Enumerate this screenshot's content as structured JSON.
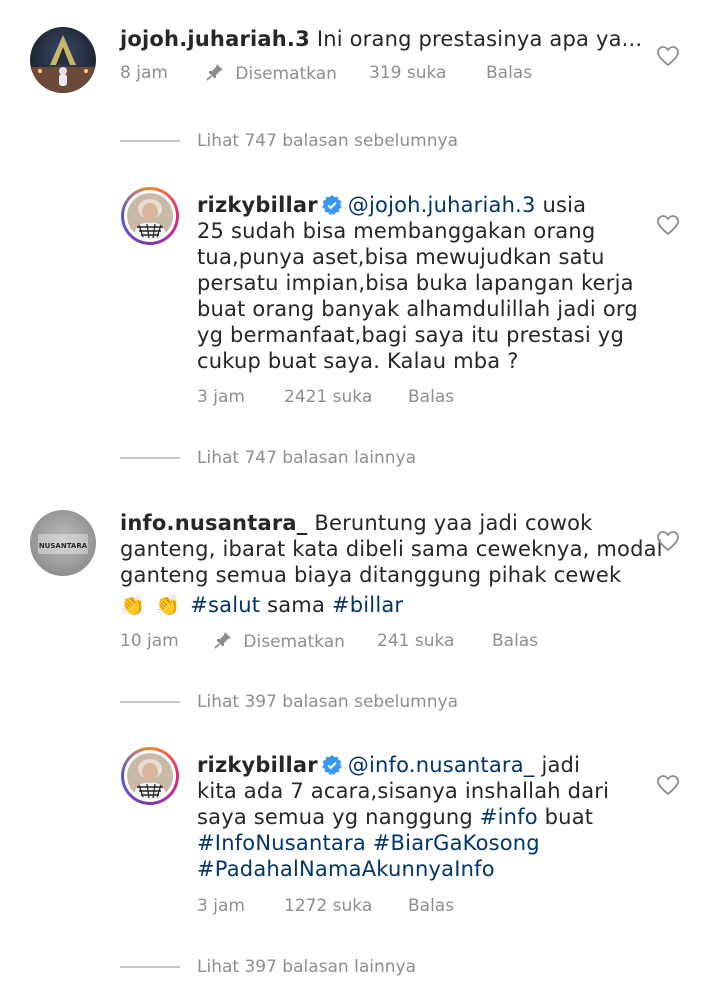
{
  "comments": [
    {
      "username": "jojoh.juhariah.3",
      "text": "Ini orang prestasinya apa  ya...",
      "time": "8 jam",
      "pinned": "Disematkan",
      "likes": "319 suka",
      "reply": "Balas"
    },
    {
      "username": "info.nusantara_",
      "line1": "Beruntung yaa jadi cowok",
      "line2": "ganteng, ibarat kata dibeli sama ceweknya, modal",
      "line3": "ganteng semua biaya ditanggung pihak cewek",
      "emoji": "👏",
      "hashtag1": "#salut",
      "word": "sama",
      "hashtag2": "#billar",
      "avatar_text": "NUSANTARA",
      "time": "10 jam",
      "pinned": "Disematkan",
      "likes": "241 suka",
      "reply": "Balas"
    }
  ],
  "replies": [
    {
      "username": "rizkybillar",
      "mention": "@jojoh.juhariah.3",
      "line1_rest": "usia",
      "lines": [
        "25 sudah bisa membanggakan orang",
        "tua,punya aset,bisa mewujudkan satu",
        "persatu impian,bisa buka lapangan kerja",
        "buat orang banyak alhamdulillah jadi org",
        "yg bermanfaat,bagi saya itu prestasi yg",
        "cukup buat saya. Kalau mba ?"
      ],
      "time": "3 jam",
      "likes": "2421 suka",
      "reply": "Balas"
    },
    {
      "username": "rizkybillar",
      "mention": "@info.nusantara_",
      "line1_rest": "jadi",
      "line2": "kita ada 7 acara,sisanya inshallah dari",
      "line3_a": "saya semua yg nanggung",
      "line3_tag": "#info",
      "line3_b": "buat",
      "line4": "#InfoNusantara #BiarGaKosong",
      "line5": "#PadahalNamaAkunnyaInfo",
      "time": "3 jam",
      "likes": "1272 suka",
      "reply": "Balas"
    }
  ],
  "view_more": [
    "Lihat 747 balasan sebelumnya",
    "Lihat 747 balasan lainnya",
    "Lihat 397 balasan sebelumnya",
    "Lihat 397 balasan lainnya"
  ],
  "colors": {
    "text": "#262626",
    "meta": "#8e8e8e",
    "link": "#003569",
    "verified": "#3897f0"
  }
}
